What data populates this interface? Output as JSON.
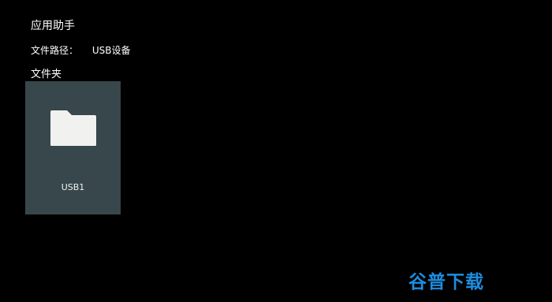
{
  "header": {
    "app_title": "应用助手"
  },
  "path": {
    "label": "文件路径：",
    "value": "USB设备"
  },
  "section": {
    "title": "文件夹"
  },
  "folders": [
    {
      "label": "USB1",
      "icon": "folder-icon"
    }
  ],
  "watermark": {
    "text": "谷普下载"
  },
  "colors": {
    "background": "#000000",
    "tile": "#37474b",
    "folder_icon": "#f1f1ef",
    "watermark": "#1d8de0"
  }
}
